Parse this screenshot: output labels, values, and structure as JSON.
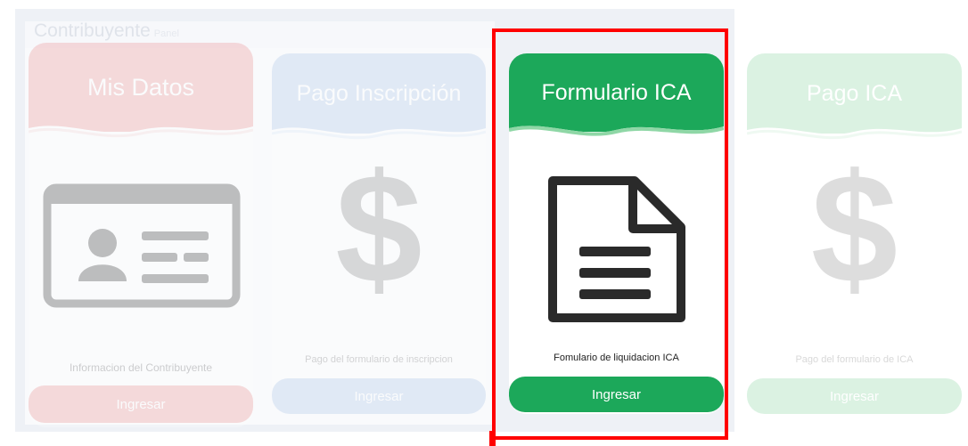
{
  "panel": {
    "title": "Contribuyente",
    "subtitle": "Panel"
  },
  "colors": {
    "red": "#ea8080",
    "blue": "#a8c3e6",
    "green": "#1ca85a",
    "light_green": "#8fd7a6"
  },
  "cards": [
    {
      "title": "Mis Datos",
      "icon": "id-card-icon",
      "description": "Informacion del Contribuyente",
      "button": "Ingresar"
    },
    {
      "title": "Pago Inscripción",
      "icon": "dollar-icon",
      "description": "Pago del formulario de inscripcion",
      "button": "Ingresar"
    },
    {
      "title": "Formulario ICA",
      "icon": "document-icon",
      "description": "Fomulario de liquidacion ICA",
      "button": "Ingresar"
    },
    {
      "title": "Pago ICA",
      "icon": "dollar-icon",
      "description": "Pago del formulario de ICA",
      "button": "Ingresar"
    }
  ]
}
